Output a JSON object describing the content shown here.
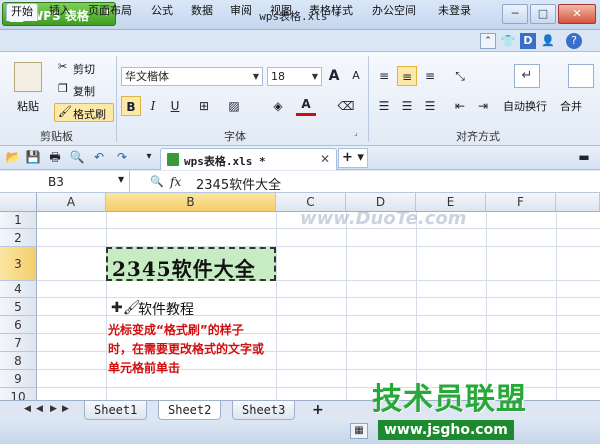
{
  "app": {
    "menu_button": "WPS 表格",
    "window_title": "wps表格.xls *"
  },
  "menu_tabs": [
    "开始",
    "插入",
    "页面布局",
    "公式",
    "数据",
    "审阅",
    "视图",
    "表格样式",
    "办公空间"
  ],
  "account": {
    "login": "未登录"
  },
  "ribbon": {
    "clipboard": {
      "paste": "粘贴",
      "cut": "剪切",
      "copy": "复制",
      "format_painter": "格式刷",
      "group_label": "剪贴板"
    },
    "font": {
      "font_name": "华文楷体",
      "font_size": "18",
      "bold": "B",
      "italic": "I",
      "underline": "U",
      "grow": "A",
      "shrink": "A",
      "font_color": "A",
      "group_label": "字体"
    },
    "align": {
      "wrap": "自动换行",
      "merge": "合并",
      "group_label": "对齐方式"
    }
  },
  "doc_tab": {
    "name": "wps表格.xls *"
  },
  "formula_bar": {
    "name_box": "B3",
    "fx": "fx",
    "content": "2345软件大全"
  },
  "grid": {
    "columns": [
      "A",
      "B",
      "C",
      "D",
      "E",
      "F"
    ],
    "rows": [
      "1",
      "2",
      "3",
      "4",
      "5",
      "6",
      "7",
      "8",
      "9",
      "10"
    ],
    "b3": "2345软件大全",
    "b5": "软件教程",
    "note_lines": [
      "光标变成“格式刷”的样子",
      "时，在需要更改格式的文字或",
      "单元格前单击"
    ]
  },
  "sheets": [
    "Sheet1",
    "Sheet2",
    "Sheet3"
  ],
  "watermark": "www.DuoTe.com",
  "brand": {
    "name": "技术员联盟",
    "url": "www.jsgho.com"
  },
  "colors": {
    "selection": "#f5cd6b",
    "cell_fill": "#c7ecc3",
    "note_red": "#d01010",
    "brand_green": "#28a838"
  }
}
